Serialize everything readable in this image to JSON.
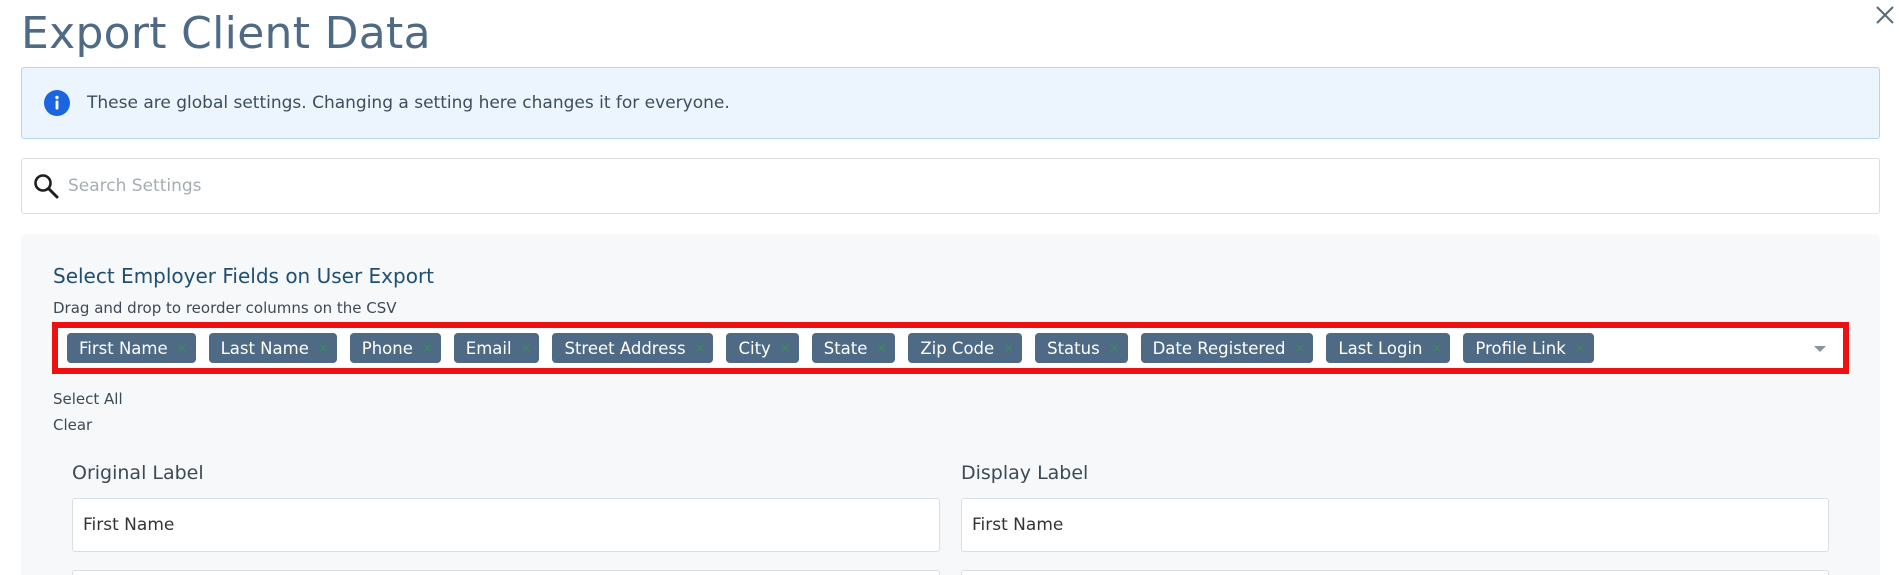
{
  "modal": {
    "title": "Export Client Data",
    "close_label": "×"
  },
  "banner": {
    "icon": "info-icon",
    "text": "These are global settings. Changing a setting here changes it for everyone."
  },
  "search": {
    "icon": "search-icon",
    "placeholder": "Search Settings",
    "value": ""
  },
  "employer_fields": {
    "title": "Select Employer Fields on User Export",
    "subtitle": "Drag and drop to reorder columns on the CSV",
    "tags": [
      "First Name",
      "Last Name",
      "Phone",
      "Email",
      "Street Address",
      "City",
      "State",
      "Zip Code",
      "Status",
      "Date Registered",
      "Last Login",
      "Profile Link"
    ],
    "tag_remove": "×",
    "select_all": "Select All",
    "clear": "Clear",
    "colors": {
      "tag_bg": "#4e6a85",
      "highlight": "#ee1111"
    }
  },
  "labels": {
    "original_header": "Original Label",
    "display_header": "Display Label",
    "rows": [
      {
        "original": "First Name",
        "display": "First Name"
      }
    ]
  }
}
